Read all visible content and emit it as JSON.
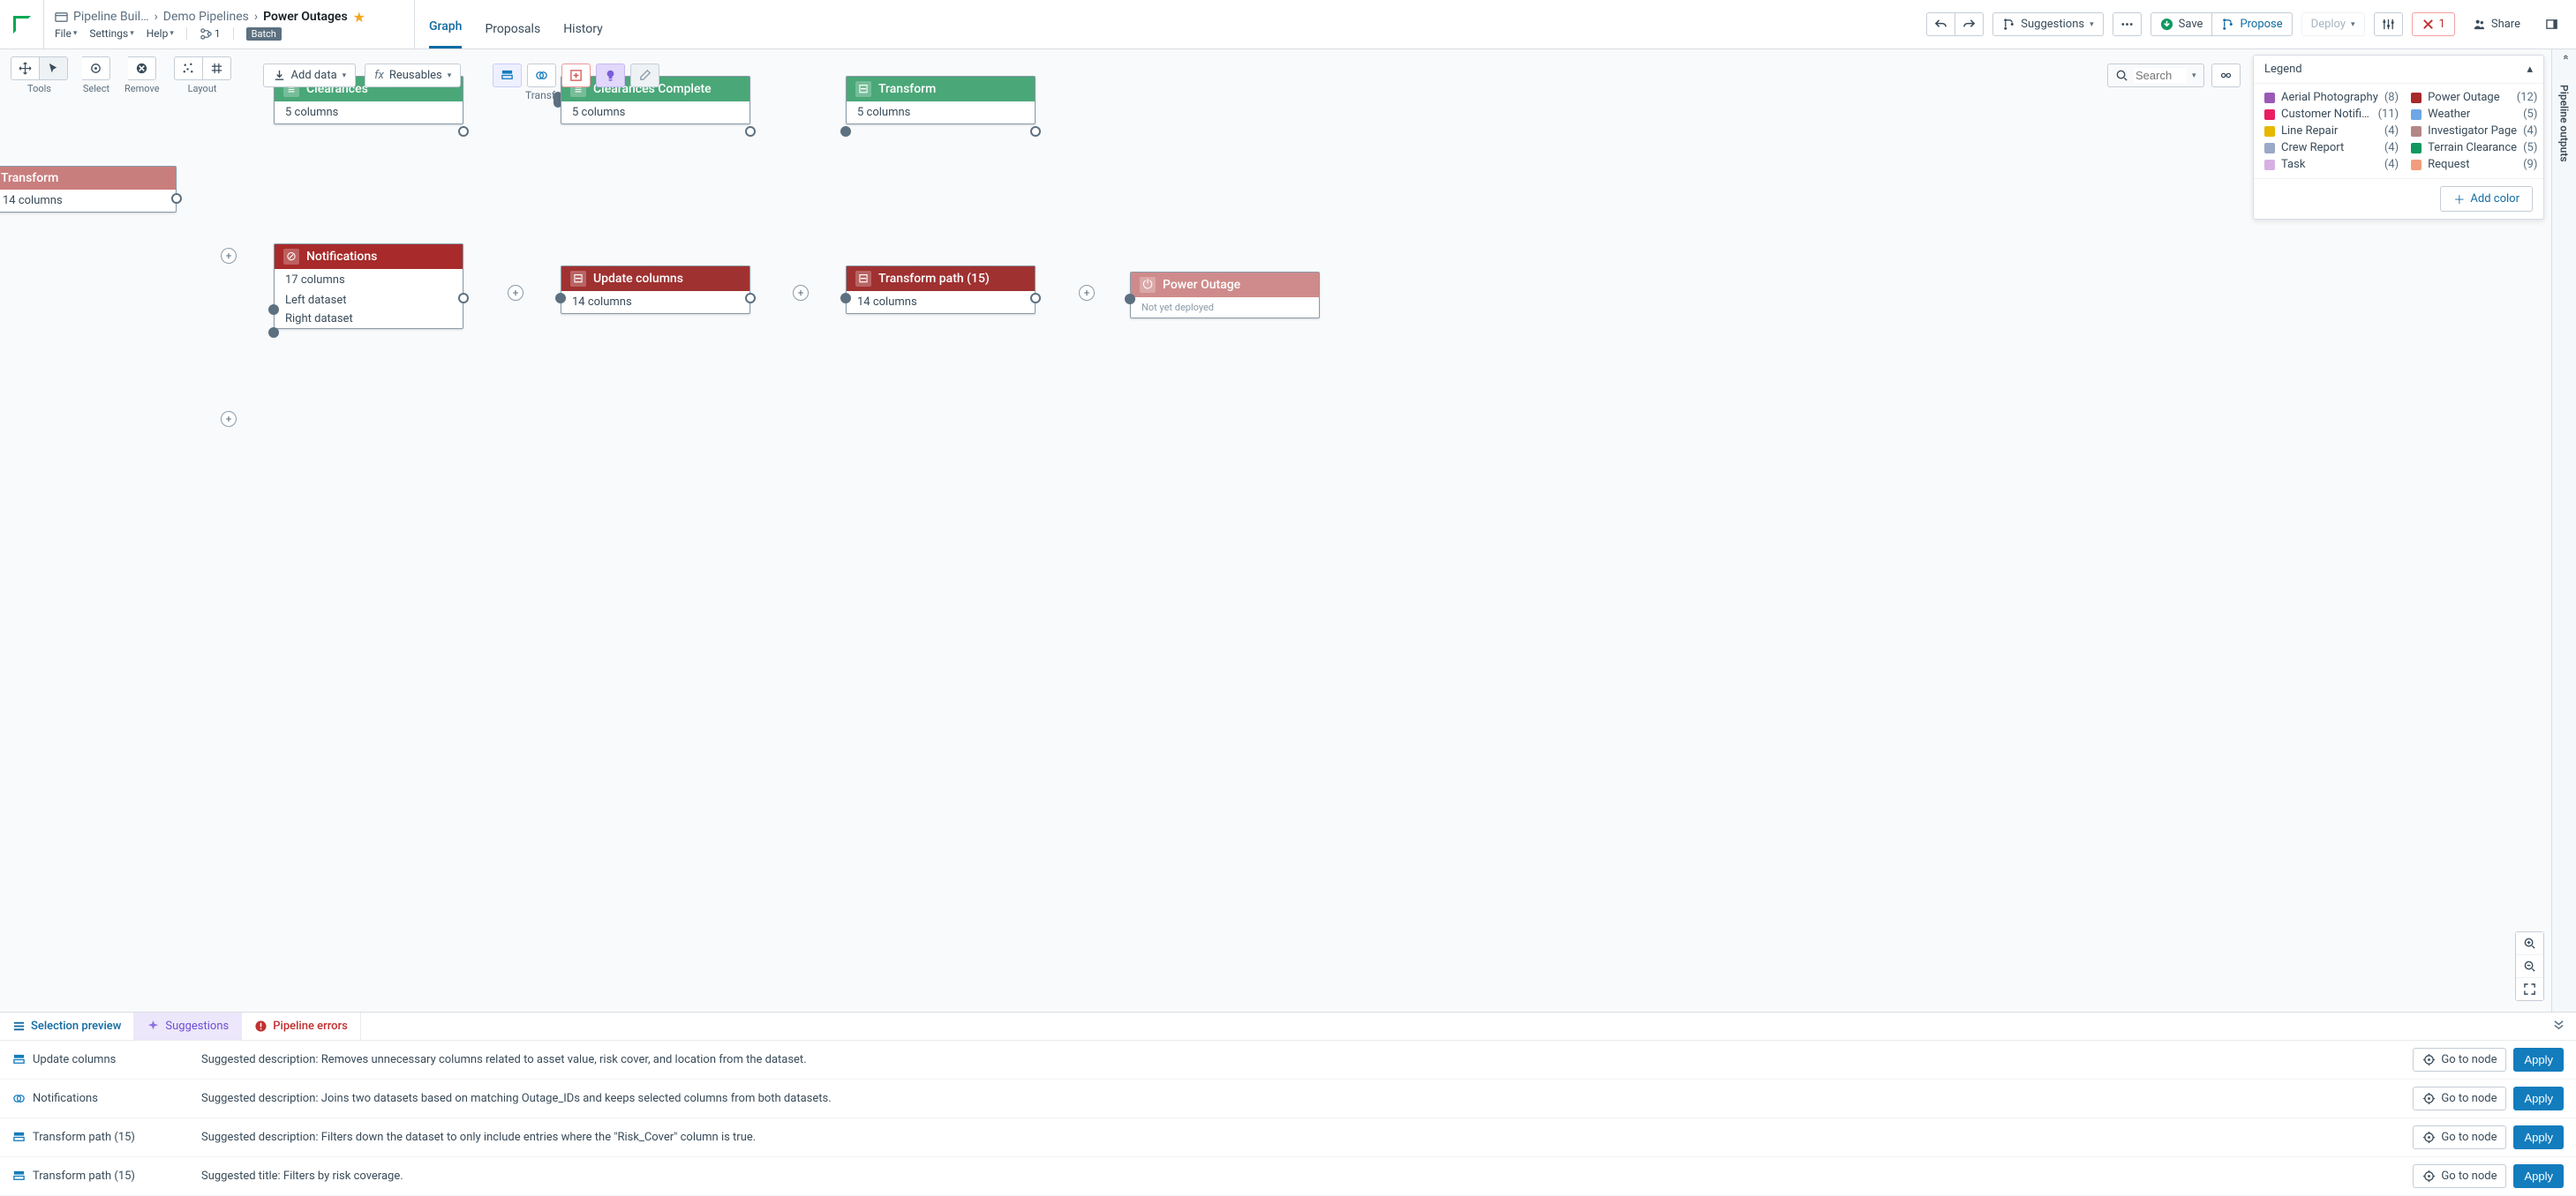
{
  "breadcrumb": {
    "root": "Pipeline Buil…",
    "mid": "Demo Pipelines",
    "current": "Power Outages"
  },
  "menubar": {
    "file": "File",
    "settings": "Settings",
    "help": "Help",
    "branch": "1",
    "badge": "Batch"
  },
  "tabs": {
    "graph": "Graph",
    "proposals": "Proposals",
    "history": "History"
  },
  "top": {
    "suggestions": "Suggestions",
    "save": "Save",
    "propose": "Propose",
    "deploy": "Deploy",
    "errors": "1",
    "share": "Share"
  },
  "toolbar": {
    "tools": "Tools",
    "select": "Select",
    "remove": "Remove",
    "layout": "Layout",
    "add_data": "Add data",
    "reusables": "Reusables",
    "search_placeholder": "Search"
  },
  "legend": {
    "title": "Legend",
    "add": "Add color",
    "items": [
      {
        "label": "Aerial Photography",
        "count": "(8)",
        "color": "#9b59b6"
      },
      {
        "label": "Power Outage",
        "count": "(12)",
        "color": "#a82a2a"
      },
      {
        "label": "Customer Notifi…",
        "count": "(11)",
        "color": "#e91e63"
      },
      {
        "label": "Weather",
        "count": "(5)",
        "color": "#6ea7e6"
      },
      {
        "label": "Line Repair",
        "count": "(4)",
        "color": "#e6b800"
      },
      {
        "label": "Investigator Page",
        "count": "(4)",
        "color": "#b48787"
      },
      {
        "label": "Crew Report",
        "count": "(4)",
        "color": "#9aa9c8"
      },
      {
        "label": "Terrain Clearance",
        "count": "(5)",
        "color": "#0f9960"
      },
      {
        "label": "Task",
        "count": "(4)",
        "color": "#d7b0e3"
      },
      {
        "label": "Request",
        "count": "(9)",
        "color": "#f29d7e"
      }
    ]
  },
  "side_tab": "Pipeline outputs",
  "nodes": {
    "clearances": {
      "title": "Clearances",
      "cols": "5 columns"
    },
    "transform_mid": {
      "title": "Transfo",
      "subtitle": ""
    },
    "clearances_complete": {
      "title": "Clearances Complete",
      "cols": "5 columns"
    },
    "transform_right": {
      "title": "Transform",
      "cols": "5 columns"
    },
    "transform_left": {
      "title": "Transform",
      "cols": "14 columns"
    },
    "notifications": {
      "title": "Notifications",
      "cols": "17 columns",
      "p1": "Left dataset",
      "p2": "Right dataset"
    },
    "update_cols": {
      "title": "Update columns",
      "cols": "14 columns"
    },
    "transform_path": {
      "title": "Transform path (15)",
      "cols": "14 columns"
    },
    "power_outage": {
      "title": "Power Outage",
      "status": "Not yet deployed"
    }
  },
  "bottom": {
    "tab1": "Selection preview",
    "tab2": "Suggestions",
    "tab3": "Pipeline errors",
    "goto": "Go to node",
    "apply": "Apply",
    "rows": [
      {
        "node": "Update columns",
        "icon": "transform",
        "msg": "Suggested description: Removes unnecessary columns related to asset value, risk cover, and location from the dataset."
      },
      {
        "node": "Notifications",
        "icon": "join",
        "msg": "Suggested description: Joins two datasets based on matching Outage_IDs and keeps selected columns from both datasets."
      },
      {
        "node": "Transform path (15)",
        "icon": "transform",
        "msg": "Suggested description: Filters down the dataset to only include entries where the \"Risk_Cover\" column is true."
      },
      {
        "node": "Transform path (15)",
        "icon": "transform",
        "msg": "Suggested title: Filters by risk coverage."
      }
    ]
  }
}
